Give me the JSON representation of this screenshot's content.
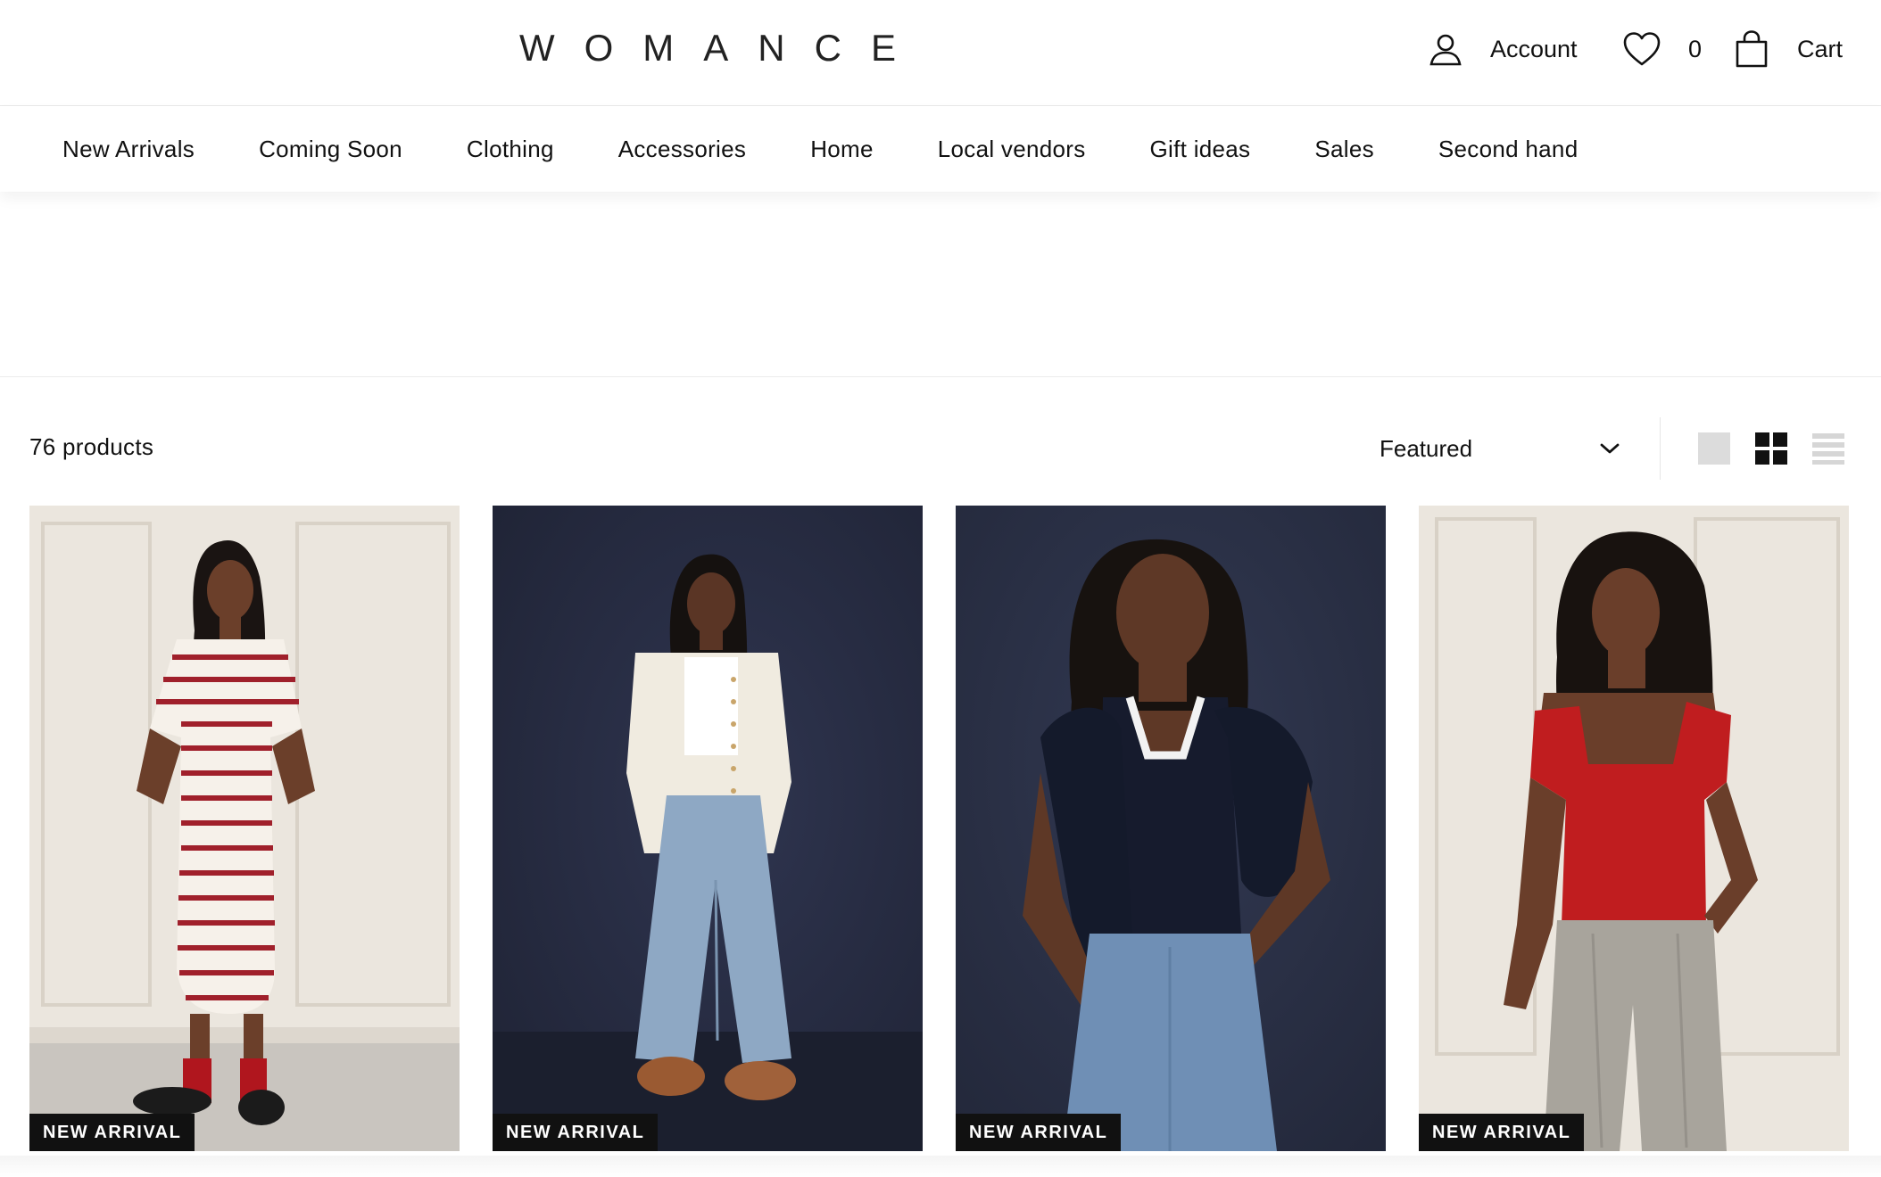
{
  "header": {
    "logo": "WOMANCE",
    "account_label": "Account",
    "wishlist_count": "0",
    "cart_label": "Cart"
  },
  "nav": {
    "items": [
      {
        "label": "New Arrivals"
      },
      {
        "label": "Coming Soon"
      },
      {
        "label": "Clothing"
      },
      {
        "label": "Accessories"
      },
      {
        "label": "Home"
      },
      {
        "label": "Local vendors"
      },
      {
        "label": "Gift ideas"
      },
      {
        "label": "Sales"
      },
      {
        "label": "Second hand"
      }
    ]
  },
  "collection": {
    "product_count": "76 products",
    "sort_selected": "Featured",
    "view_modes": [
      "large-view-icon",
      "grid-view-icon",
      "list-view-icon"
    ]
  },
  "products": [
    {
      "badge": "NEW ARRIVAL",
      "image": "woman in red striped t-shirt dress, red socks, black loafers, cream panelled wall"
    },
    {
      "badge": "NEW ARRIVAL",
      "image": "woman in cream cardigan, white crop top, wide light-wash jeans, tan clogs, navy backdrop"
    },
    {
      "badge": "NEW ARRIVAL",
      "image": "woman in navy tank with white trim, navy sweater over shoulders, jeans, navy backdrop"
    },
    {
      "badge": "NEW ARRIVAL",
      "image": "woman in red square-neck top, grey pleated trousers, cream panelled wall"
    }
  ],
  "colors": {
    "text": "#111111",
    "badge_bg": "#111111",
    "badge_text": "#ffffff",
    "accent_red": "#b3202a",
    "navy_backdrop": "#262c3f",
    "cream_wall": "#e9e4dc"
  }
}
